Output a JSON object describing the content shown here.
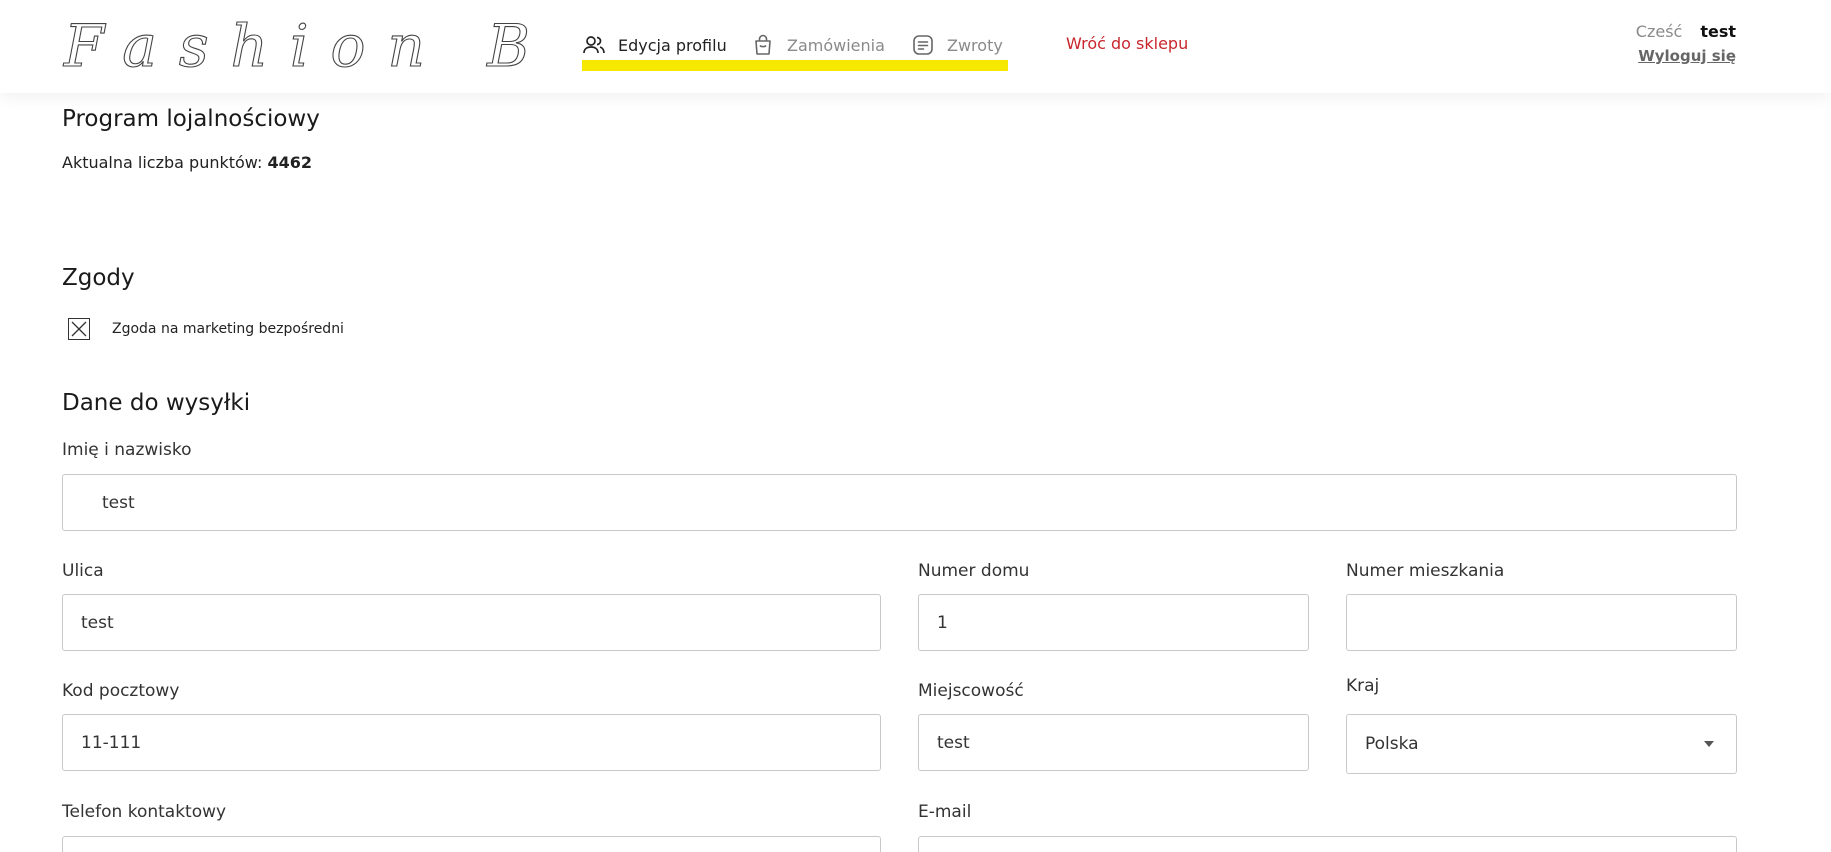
{
  "header": {
    "logo_text": "Fashion Brand",
    "nav": [
      {
        "label": "Edycja profilu",
        "icon": "users-icon",
        "active": true
      },
      {
        "label": "Zamówienia",
        "icon": "shopping-bag-icon",
        "active": false
      },
      {
        "label": "Zwroty",
        "icon": "document-lines-icon",
        "active": false
      }
    ],
    "back_link": "Wróć do sklepu",
    "greeting_label": "Cześć",
    "user_name": "test",
    "logout_label": "Wyloguj się"
  },
  "loyalty": {
    "title": "Program lojalnościowy",
    "points_label": "Aktualna liczba punktów:",
    "points_value": "4462"
  },
  "consents": {
    "title": "Zgody",
    "items": [
      {
        "label": "Zgoda na marketing bezpośredni",
        "checked": true
      }
    ]
  },
  "shipping": {
    "title": "Dane do wysyłki",
    "fields": {
      "full_name": {
        "label": "Imię i nazwisko",
        "value": "test"
      },
      "street": {
        "label": "Ulica",
        "value": "test"
      },
      "house_number": {
        "label": "Numer domu",
        "value": "1"
      },
      "apartment_number": {
        "label": "Numer mieszkania",
        "value": ""
      },
      "postal_code": {
        "label": "Kod pocztowy",
        "value": "11-111"
      },
      "city": {
        "label": "Miejscowość",
        "value": "test"
      },
      "country": {
        "label": "Kraj",
        "value": "Polska"
      },
      "phone": {
        "label": "Telefon kontaktowy",
        "value": ""
      },
      "email": {
        "label": "E-mail",
        "value": ""
      }
    }
  },
  "colors": {
    "highlight": "#f7e800",
    "back_link": "#c8262d",
    "muted_text": "#8a8a8a",
    "border": "#c9c9c9"
  }
}
